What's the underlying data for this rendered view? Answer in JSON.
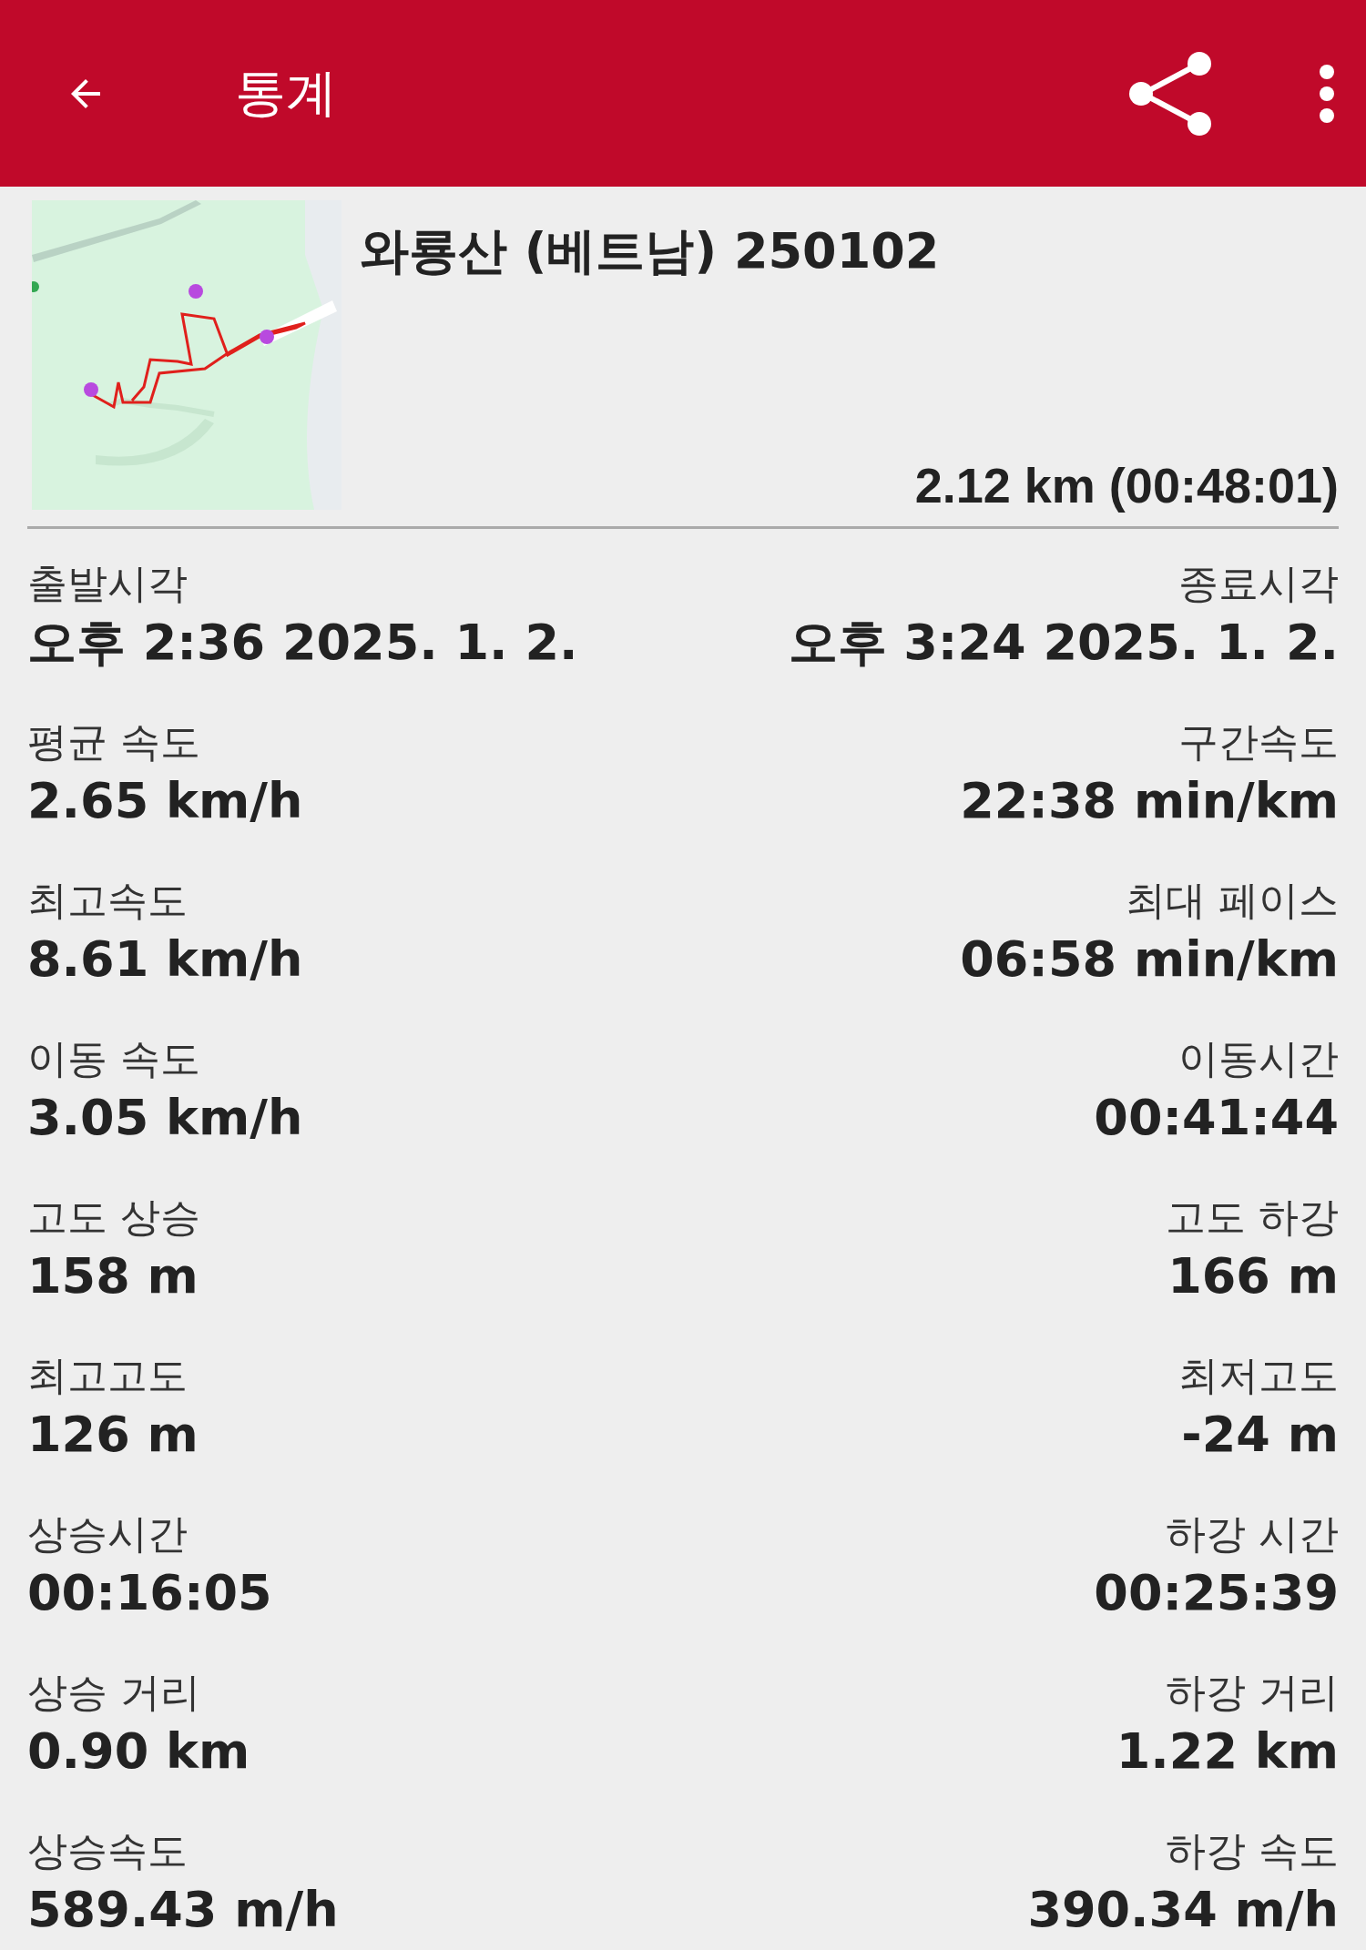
{
  "app_bar": {
    "title": "통계"
  },
  "track": {
    "name": "와룡산 (베트남) 250102",
    "summary": "2.12 km (00:48:01)"
  },
  "stats": [
    {
      "left": {
        "label": "출발시각",
        "value": "오후 2:36 2025. 1. 2."
      },
      "right": {
        "label": "종료시각",
        "value": "오후 3:24 2025. 1. 2."
      }
    },
    {
      "left": {
        "label": "평균 속도",
        "value": "2.65 km/h"
      },
      "right": {
        "label": "구간속도",
        "value": "22:38 min/km"
      }
    },
    {
      "left": {
        "label": "최고속도",
        "value": "8.61 km/h"
      },
      "right": {
        "label": "최대 페이스",
        "value": "06:58 min/km"
      }
    },
    {
      "left": {
        "label": "이동 속도",
        "value": "3.05 km/h"
      },
      "right": {
        "label": "이동시간",
        "value": "00:41:44"
      }
    },
    {
      "left": {
        "label": "고도 상승",
        "value": "158 m"
      },
      "right": {
        "label": "고도 하강",
        "value": "166 m"
      }
    },
    {
      "left": {
        "label": "최고고도",
        "value": "126 m"
      },
      "right": {
        "label": "최저고도",
        "value": "-24 m"
      }
    },
    {
      "left": {
        "label": "상승시간",
        "value": "00:16:05"
      },
      "right": {
        "label": "하강 시간",
        "value": "00:25:39"
      }
    },
    {
      "left": {
        "label": "상승 거리",
        "value": "0.90 km"
      },
      "right": {
        "label": "하강 거리",
        "value": "1.22 km"
      }
    },
    {
      "left": {
        "label": "상승속도",
        "value": "589.43 m/h"
      },
      "right": {
        "label": "하강 속도",
        "value": "390.34 m/h"
      }
    }
  ]
}
